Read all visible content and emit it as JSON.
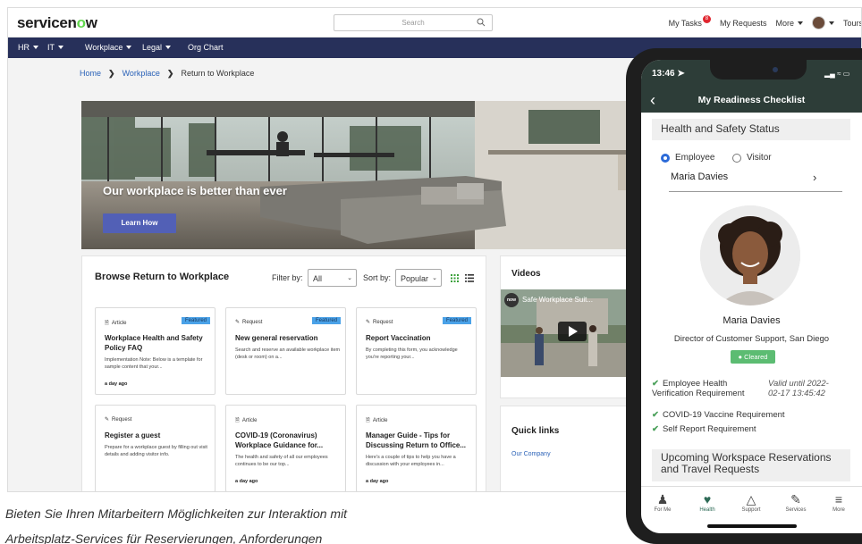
{
  "topbar": {
    "logo_pre": "servicen",
    "logo_o": "o",
    "logo_post": "w",
    "search_placeholder": "Search",
    "my_tasks": "My Tasks",
    "tasks_badge": "8",
    "my_requests": "My Requests",
    "more": "More",
    "tours": "Tours"
  },
  "menu": [
    "HR",
    "IT",
    "Workplace",
    "Legal",
    "Org Chart"
  ],
  "breadcrumb": {
    "home": "Home",
    "workplace": "Workplace",
    "current": "Return to Workplace"
  },
  "hero": {
    "headline": "Our workplace is better than ever",
    "button": "Learn How"
  },
  "browse": {
    "title": "Browse Return to Workplace",
    "filter_label": "Filter by:",
    "filter_value": "All",
    "sort_label": "Sort by:",
    "sort_value": "Popular",
    "cards": [
      {
        "type": "Article",
        "featured": "Featured",
        "title": "Workplace Health and Safety Policy FAQ",
        "desc": "Implementation Note: Below is a template for sample content that your...",
        "ago": "a day ago"
      },
      {
        "type": "Request",
        "featured": "Featured",
        "title": "New general reservation",
        "desc": "Search and reserve an available workplace item (desk or room) on a...",
        "ago": ""
      },
      {
        "type": "Request",
        "featured": "Featured",
        "title": "Report Vaccination",
        "desc": "By completing this form, you acknowledge you're reporting your...",
        "ago": ""
      },
      {
        "type": "Request",
        "featured": "",
        "title": "Register a guest",
        "desc": "Prepare for a workplace guest by filling out visit details and adding visitor info.",
        "ago": ""
      },
      {
        "type": "Article",
        "featured": "",
        "title": "COVID-19 (Coronavirus) Workplace Guidance for...",
        "desc": "The health and safety of all our employees continues to be our top...",
        "ago": "a day ago"
      },
      {
        "type": "Article",
        "featured": "",
        "title": "Manager Guide - Tips for Discussing Return to Office...",
        "desc": "Here's a couple of tips to help you have a discussion with your employees in...",
        "ago": "a day ago"
      }
    ]
  },
  "videos": {
    "title": "Videos",
    "video_title": "Safe Workplace Suit..."
  },
  "quick_links": {
    "title": "Quick links",
    "link": "Our Company"
  },
  "caption": {
    "line1": "Bieten Sie Ihren Mitarbeitern Möglichkeiten zur Interaktion mit",
    "line2": "Arbeitsplatz-Services für Reservierungen, Anforderungen"
  },
  "phone": {
    "time": "13:46",
    "title": "My Readiness Checklist",
    "section_health": "Health and Safety Status",
    "radio_employee": "Employee",
    "radio_visitor": "Visitor",
    "person_field": "Maria Davies",
    "name": "Maria Davies",
    "role": "Director of Customer Support, San Diego",
    "status": "Cleared",
    "requirements": [
      {
        "line1": "Employee Health",
        "line2": "Verification Requirement",
        "valid1": "Valid until 2022-",
        "valid2": "02-17 13:45:42"
      },
      {
        "line1": "COVID-19 Vaccine Requirement"
      },
      {
        "line1": "Self Report Requirement"
      }
    ],
    "section_upcoming": "Upcoming Workspace Reservations and Travel Requests",
    "tabs": [
      "For Me",
      "Health",
      "Support",
      "Services",
      "More"
    ],
    "active_tab": "Health",
    "colors": {
      "header": "#2d3d38",
      "active": "#2d6a56",
      "cleared": "#5cbc72"
    }
  }
}
